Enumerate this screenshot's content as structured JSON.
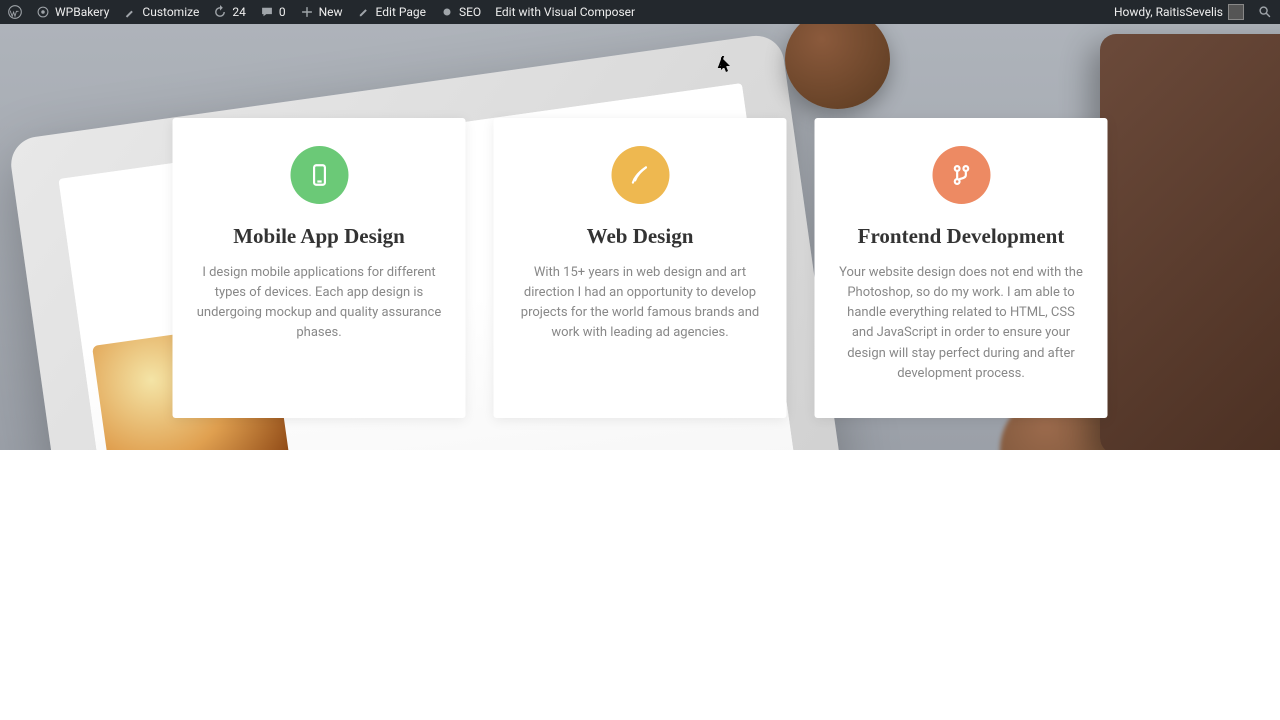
{
  "adminbar": {
    "site_name": "WPBakery",
    "customize": "Customize",
    "updates_count": "24",
    "comments_count": "0",
    "new_label": "New",
    "edit_page": "Edit Page",
    "seo": "SEO",
    "edit_vc": "Edit with Visual Composer",
    "greeting": "Howdy, RaitisSevelis"
  },
  "cards": [
    {
      "title": "Mobile App Design",
      "body": "I design mobile applications for different types of devices. Each app design is undergoing mockup and quality assurance phases.",
      "icon_color": "#6bc977"
    },
    {
      "title": "Web Design",
      "body": "With 15+ years in web design and art direction I had an opportunity to develop projects for the world famous brands and work with leading ad agencies.",
      "icon_color": "#eeb850"
    },
    {
      "title": "Frontend Development",
      "body": "Your website design does not end with the Photoshop, so do my work. I am able to handle everything related to HTML, CSS and JavaScript in order to ensure your design will stay perfect during and after development process.",
      "icon_color": "#ed8a63"
    }
  ]
}
